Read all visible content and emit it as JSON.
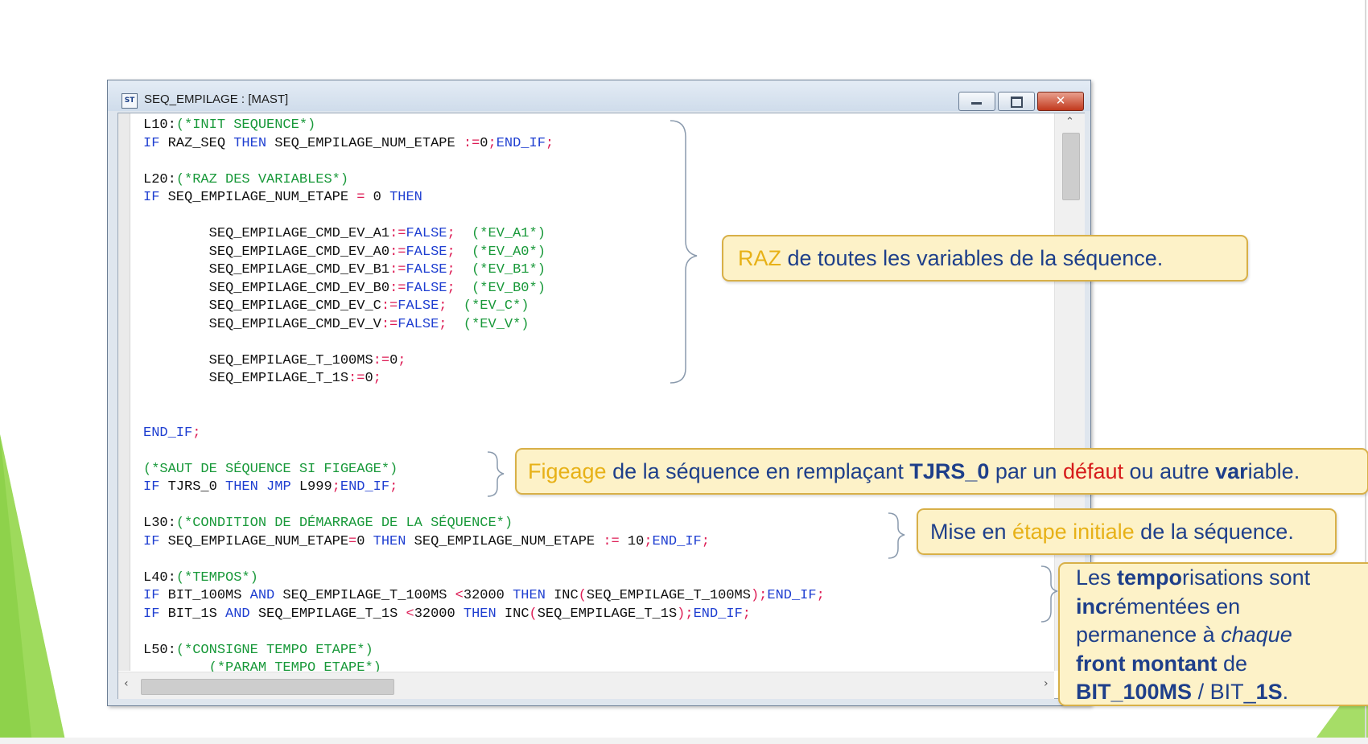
{
  "window": {
    "title": "SEQ_EMPILAGE : [MAST]",
    "icon": "program-icon",
    "icon_text": "ST"
  },
  "code_lines": [
    [
      {
        "t": "L10:",
        "c": "tx"
      },
      {
        "t": "(*INIT SEQUENCE*)",
        "c": "cm"
      }
    ],
    [
      {
        "t": "IF",
        "c": "kw"
      },
      {
        "t": " RAZ_SEQ ",
        "c": "tx"
      },
      {
        "t": "THEN",
        "c": "kw"
      },
      {
        "t": " SEQ_EMPILAGE_NUM_ETAPE ",
        "c": "tx"
      },
      {
        "t": ":=",
        "c": "op"
      },
      {
        "t": "0",
        "c": "tx"
      },
      {
        "t": ";",
        "c": "op"
      },
      {
        "t": "END_IF",
        "c": "kw"
      },
      {
        "t": ";",
        "c": "op"
      }
    ],
    [],
    [
      {
        "t": "L20:",
        "c": "tx"
      },
      {
        "t": "(*RAZ DES VARIABLES*)",
        "c": "cm"
      }
    ],
    [
      {
        "t": "IF",
        "c": "kw"
      },
      {
        "t": " SEQ_EMPILAGE_NUM_ETAPE ",
        "c": "tx"
      },
      {
        "t": "=",
        "c": "op"
      },
      {
        "t": " 0 ",
        "c": "tx"
      },
      {
        "t": "THEN",
        "c": "kw"
      }
    ],
    [],
    [
      {
        "t": "        SEQ_EMPILAGE_CMD_EV_A1",
        "c": "tx"
      },
      {
        "t": ":=",
        "c": "op"
      },
      {
        "t": "FALSE",
        "c": "kw"
      },
      {
        "t": ";",
        "c": "op"
      },
      {
        "t": "  (*EV_A1*)",
        "c": "cm"
      }
    ],
    [
      {
        "t": "        SEQ_EMPILAGE_CMD_EV_A0",
        "c": "tx"
      },
      {
        "t": ":=",
        "c": "op"
      },
      {
        "t": "FALSE",
        "c": "kw"
      },
      {
        "t": ";",
        "c": "op"
      },
      {
        "t": "  (*EV_A0*)",
        "c": "cm"
      }
    ],
    [
      {
        "t": "        SEQ_EMPILAGE_CMD_EV_B1",
        "c": "tx"
      },
      {
        "t": ":=",
        "c": "op"
      },
      {
        "t": "FALSE",
        "c": "kw"
      },
      {
        "t": ";",
        "c": "op"
      },
      {
        "t": "  (*EV_B1*)",
        "c": "cm"
      }
    ],
    [
      {
        "t": "        SEQ_EMPILAGE_CMD_EV_B0",
        "c": "tx"
      },
      {
        "t": ":=",
        "c": "op"
      },
      {
        "t": "FALSE",
        "c": "kw"
      },
      {
        "t": ";",
        "c": "op"
      },
      {
        "t": "  (*EV_B0*)",
        "c": "cm"
      }
    ],
    [
      {
        "t": "        SEQ_EMPILAGE_CMD_EV_C",
        "c": "tx"
      },
      {
        "t": ":=",
        "c": "op"
      },
      {
        "t": "FALSE",
        "c": "kw"
      },
      {
        "t": ";",
        "c": "op"
      },
      {
        "t": "  (*EV_C*)",
        "c": "cm"
      }
    ],
    [
      {
        "t": "        SEQ_EMPILAGE_CMD_EV_V",
        "c": "tx"
      },
      {
        "t": ":=",
        "c": "op"
      },
      {
        "t": "FALSE",
        "c": "kw"
      },
      {
        "t": ";",
        "c": "op"
      },
      {
        "t": "  (*EV_V*)",
        "c": "cm"
      }
    ],
    [],
    [
      {
        "t": "        SEQ_EMPILAGE_T_100MS",
        "c": "tx"
      },
      {
        "t": ":=",
        "c": "op"
      },
      {
        "t": "0",
        "c": "tx"
      },
      {
        "t": ";",
        "c": "op"
      }
    ],
    [
      {
        "t": "        SEQ_EMPILAGE_T_1S",
        "c": "tx"
      },
      {
        "t": ":=",
        "c": "op"
      },
      {
        "t": "0",
        "c": "tx"
      },
      {
        "t": ";",
        "c": "op"
      }
    ],
    [],
    [],
    [
      {
        "t": "END_IF",
        "c": "kw"
      },
      {
        "t": ";",
        "c": "op"
      }
    ],
    [],
    [
      {
        "t": "(*SAUT DE SÉQUENCE SI FIGEAGE*)",
        "c": "cm"
      }
    ],
    [
      {
        "t": "IF",
        "c": "kw"
      },
      {
        "t": " TJRS_0 ",
        "c": "tx"
      },
      {
        "t": "THEN",
        "c": "kw"
      },
      {
        "t": " ",
        "c": "tx"
      },
      {
        "t": "JMP",
        "c": "kw"
      },
      {
        "t": " L999",
        "c": "tx"
      },
      {
        "t": ";",
        "c": "op"
      },
      {
        "t": "END_IF",
        "c": "kw"
      },
      {
        "t": ";",
        "c": "op"
      }
    ],
    [],
    [
      {
        "t": "L30:",
        "c": "tx"
      },
      {
        "t": "(*CONDITION DE DÉMARRAGE DE LA SÉQUENCE*)",
        "c": "cm"
      }
    ],
    [
      {
        "t": "IF",
        "c": "kw"
      },
      {
        "t": " SEQ_EMPILAGE_NUM_ETAPE",
        "c": "tx"
      },
      {
        "t": "=",
        "c": "op"
      },
      {
        "t": "0 ",
        "c": "tx"
      },
      {
        "t": "THEN",
        "c": "kw"
      },
      {
        "t": " SEQ_EMPILAGE_NUM_ETAPE ",
        "c": "tx"
      },
      {
        "t": ":=",
        "c": "op"
      },
      {
        "t": " 10",
        "c": "tx"
      },
      {
        "t": ";",
        "c": "op"
      },
      {
        "t": "END_IF",
        "c": "kw"
      },
      {
        "t": ";",
        "c": "op"
      }
    ],
    [],
    [
      {
        "t": "L40:",
        "c": "tx"
      },
      {
        "t": "(*TEMPOS*)",
        "c": "cm"
      }
    ],
    [
      {
        "t": "IF",
        "c": "kw"
      },
      {
        "t": " BIT_100MS ",
        "c": "tx"
      },
      {
        "t": "AND",
        "c": "kw"
      },
      {
        "t": " SEQ_EMPILAGE_T_100MS ",
        "c": "tx"
      },
      {
        "t": "<",
        "c": "op"
      },
      {
        "t": "32000 ",
        "c": "tx"
      },
      {
        "t": "THEN",
        "c": "kw"
      },
      {
        "t": " INC",
        "c": "tx"
      },
      {
        "t": "(",
        "c": "op"
      },
      {
        "t": "SEQ_EMPILAGE_T_100MS",
        "c": "tx"
      },
      {
        "t": ");",
        "c": "op"
      },
      {
        "t": "END_IF",
        "c": "kw"
      },
      {
        "t": ";",
        "c": "op"
      }
    ],
    [
      {
        "t": "IF",
        "c": "kw"
      },
      {
        "t": " BIT_1S ",
        "c": "tx"
      },
      {
        "t": "AND",
        "c": "kw"
      },
      {
        "t": " SEQ_EMPILAGE_T_1S ",
        "c": "tx"
      },
      {
        "t": "<",
        "c": "op"
      },
      {
        "t": "32000 ",
        "c": "tx"
      },
      {
        "t": "THEN",
        "c": "kw"
      },
      {
        "t": " INC",
        "c": "tx"
      },
      {
        "t": "(",
        "c": "op"
      },
      {
        "t": "SEQ_EMPILAGE_T_1S",
        "c": "tx"
      },
      {
        "t": ");",
        "c": "op"
      },
      {
        "t": "END_IF",
        "c": "kw"
      },
      {
        "t": ";",
        "c": "op"
      }
    ],
    [],
    [
      {
        "t": "L50:",
        "c": "tx"
      },
      {
        "t": "(*CONSIGNE TEMPO ETAPE*)",
        "c": "cm"
      }
    ],
    [
      {
        "t": "        (*PARAM TEMPO ETAPE*)",
        "c": "cm"
      }
    ]
  ],
  "callouts": {
    "raz": {
      "part1": "RAZ",
      "part2": " de toutes les variables de la séquence."
    },
    "figeage": {
      "part1": "Figeage",
      "part2": " de la séquence en remplaçant ",
      "part3": "TJRS_0",
      "part4": " par un ",
      "part5": "défaut",
      "part6": " ou autre ",
      "part7": "var",
      "part8": "iable."
    },
    "etape": {
      "part1": "Mise en ",
      "part2": "étape initiale",
      "part3": " de la séquence."
    },
    "tempo": {
      "l1a": "Les ",
      "l1b": "tempo",
      "l1c": "risations sont",
      "l2a": "inc",
      "l2b": "rémentées en",
      "l3a": "permanence à ",
      "l3b": "chaque",
      "l4a": "front montant",
      "l4b": " de",
      "l5a": "BIT_100MS",
      "l5b": " / BIT_",
      "l5c": "1S",
      "l5d": "."
    }
  },
  "colors": {
    "keyword": "#1f3fd1",
    "comment": "#19993a",
    "operator": "#dd1c55",
    "callout_bg": "#fdf2c8",
    "callout_border": "#d8b048",
    "callout_text": "#1e3f8a",
    "highlight_yellow": "#e7b117",
    "highlight_red": "#d61b1b",
    "slide_green": "#8ed24b"
  }
}
